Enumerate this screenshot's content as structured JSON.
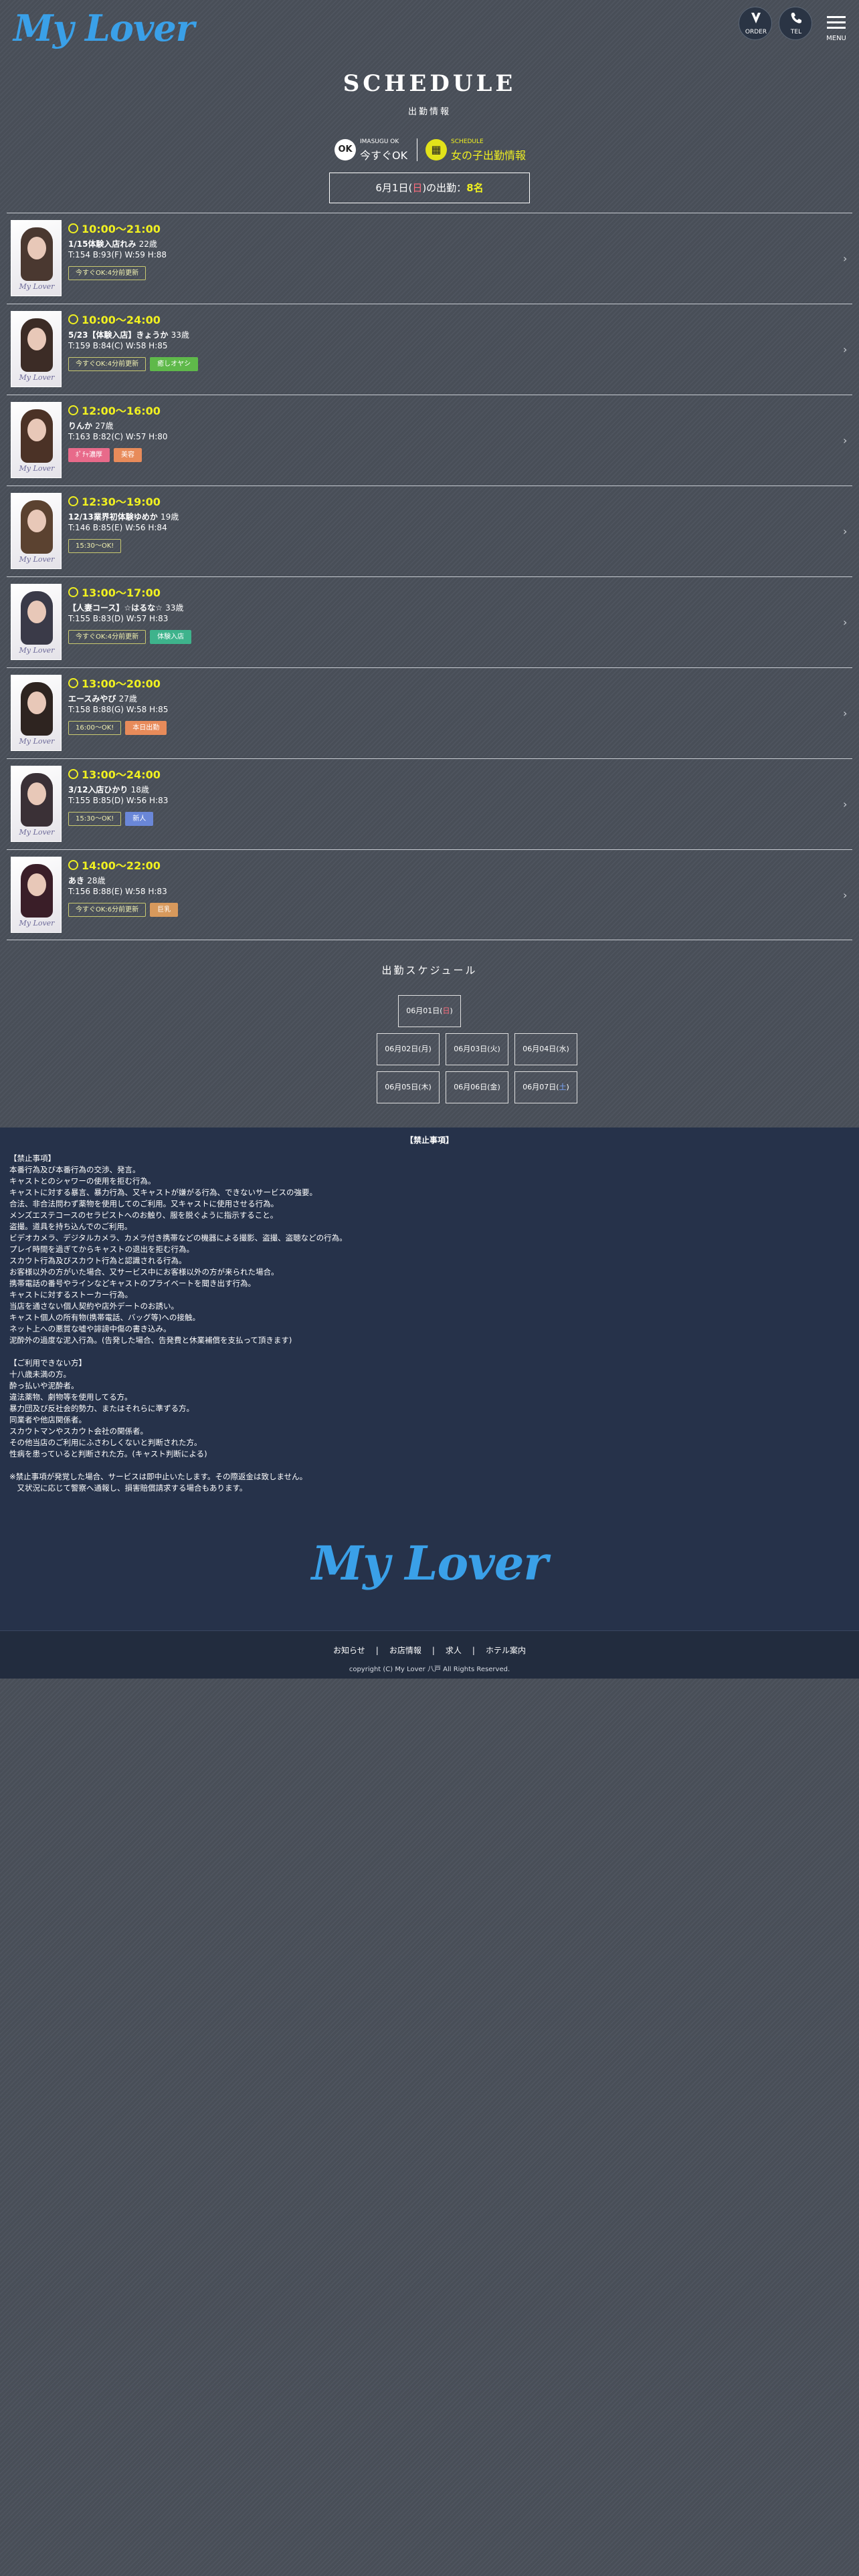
{
  "header": {
    "logo": "My Lover",
    "order_label": "ORDER",
    "tel_label": "TEL",
    "menu_label": "MENU"
  },
  "page": {
    "title": "SCHEDULE",
    "subtitle": "出勤情報"
  },
  "status": {
    "ok_badge": "OK",
    "ok_small": "IMASUGU OK",
    "ok_big": "今すぐOK",
    "sched_small": "SCHEDULE",
    "sched_big": "女の子出勤情報"
  },
  "today": {
    "date": "6月1日(",
    "weekday": "日",
    "suffix": ")の出勤：",
    "count": "8名"
  },
  "casts": [
    {
      "time": "10:00〜21:00",
      "name": "1/15体験入店れみ",
      "age": "22歳",
      "spec": "T:154 B:93(F) W:59 H:88",
      "tags": [
        {
          "label": "今すぐOK:4分前更新",
          "kind": "ok"
        }
      ],
      "hair": "#4a3830"
    },
    {
      "time": "10:00〜24:00",
      "name": "5/23【体験入店】きょうか",
      "age": "33歳",
      "spec": "T:159 B:84(C) W:58 H:85",
      "tags": [
        {
          "label": "今すぐOK:4分前更新",
          "kind": "ok"
        },
        {
          "label": "癒しオヤシ",
          "kind": "green"
        }
      ],
      "hair": "#3c2c26"
    },
    {
      "time": "12:00〜16:00",
      "name": "りんか",
      "age": "27歳",
      "spec": "T:163 B:82(C) W:57 H:80",
      "tags": [
        {
          "label": "ﾎﾟﾁｬ濃厚",
          "kind": "pink"
        },
        {
          "label": "美容",
          "kind": "orange"
        }
      ],
      "hair": "#4b3226"
    },
    {
      "time": "12:30〜19:00",
      "name": "12/13業界初体験ゆめか",
      "age": "19歳",
      "spec": "T:146 B:85(E) W:56 H:84",
      "tags": [
        {
          "label": "15:30〜OK!",
          "kind": "ok"
        }
      ],
      "hair": "#5b4230"
    },
    {
      "time": "13:00〜17:00",
      "name": "【人妻コース】☆はるな☆",
      "age": "33歳",
      "spec": "T:155 B:83(D) W:57 H:83",
      "tags": [
        {
          "label": "今すぐOK:4分前更新",
          "kind": "ok"
        },
        {
          "label": "体験入店",
          "kind": "teal"
        }
      ],
      "hair": "#3a3a48"
    },
    {
      "time": "13:00〜20:00",
      "name": "エースみやび",
      "age": "27歳",
      "spec": "T:158 B:88(G) W:58 H:85",
      "tags": [
        {
          "label": "16:00〜OK!",
          "kind": "ok"
        },
        {
          "label": "本日出勤",
          "kind": "orange"
        }
      ],
      "hair": "#2e2420"
    },
    {
      "time": "13:00〜24:00",
      "name": "3/12入店ひかり",
      "age": "18歳",
      "spec": "T:155 B:85(D) W:56 H:83",
      "tags": [
        {
          "label": "15:30〜OK!",
          "kind": "ok"
        },
        {
          "label": "新人",
          "kind": "blue"
        }
      ],
      "hair": "#3a3036"
    },
    {
      "time": "14:00〜22:00",
      "name": "あき",
      "age": "28歳",
      "spec": "T:156 B:88(E) W:58 H:83",
      "tags": [
        {
          "label": "今すぐOK:6分前更新",
          "kind": "ok"
        },
        {
          "label": "巨乳",
          "kind": "tan"
        }
      ],
      "hair": "#3a1e28"
    }
  ],
  "schedule": {
    "title": "出勤スケジュール",
    "days": [
      {
        "pre": "06月01日(",
        "wd": "日",
        "post": ")",
        "kind": "sun"
      },
      {
        "pre": "06月02日(",
        "wd": "月",
        "post": ")",
        "kind": ""
      },
      {
        "pre": "06月03日(",
        "wd": "火",
        "post": ")",
        "kind": ""
      },
      {
        "pre": "06月04日(",
        "wd": "水",
        "post": ")",
        "kind": ""
      },
      {
        "pre": "06月05日(",
        "wd": "木",
        "post": ")",
        "kind": ""
      },
      {
        "pre": "06月06日(",
        "wd": "金",
        "post": ")",
        "kind": ""
      },
      {
        "pre": "06月07日(",
        "wd": "土",
        "post": ")",
        "kind": "sat"
      }
    ]
  },
  "rules": {
    "heading": "【禁止事項】",
    "lines": [
      "【禁止事項】",
      "本番行為及び本番行為の交渉、発言。",
      "キャストとのシャワーの使用を拒む行為。",
      "キャストに対する暴言、暴力行為、又キャストが嫌がる行為、できないサービスの強要。",
      "合法、非合法問わず薬物を使用してのご利用。又キャストに使用させる行為。",
      "メンズエステコースのセラピストへのお触り、服を脱ぐように指示すること。",
      "盗撮。道具を持ち込んでのご利用。",
      "ビデオカメラ、デジタルカメラ、カメラ付き携帯などの機器による撮影、盗撮、盗聴などの行為。",
      "プレイ時間を過ぎてからキャストの退出を拒む行為。",
      "スカウト行為及びスカウト行為と認識される行為。",
      "お客様以外の方がいた場合、又サービス中にお客様以外の方が来られた場合。",
      "携帯電話の番号やラインなどキャストのプライベートを聞き出す行為。",
      "キャストに対するストーカー行為。",
      "当店を通さない個人契約や店外デートのお誘い。",
      "キャスト個人の所有物(携帯電話、バッグ等)への接触。",
      "ネット上への悪質な嘘や誹謗中傷の書き込み。",
      "泥酔外の過度な泥入行為。(告発した場合、告発費と休業補償を支払って頂きます)",
      "",
      "【ご利用できない方】",
      "十八歳未満の方。",
      "酔っ払いや泥酔者。",
      "違法薬物、劇物等を使用してる方。",
      "暴力団及び反社会的勢力、またはそれらに準ずる方。",
      "同業者や他店関係者。",
      "スカウトマンやスカウト会社の関係者。",
      "その他当店のご利用にふさわしくないと判断された方。",
      "性病を患っていると判断された方。(キャスト判断による)",
      "",
      "※禁止事項が発覚した場合、サービスは即中止いたします。その際返金は致しません。",
      "　又状況に応じて警察へ通報し、損害賠償請求する場合もあります。"
    ],
    "logo": "My Lover"
  },
  "footer": {
    "links": [
      "お知らせ",
      "お店情報",
      "求人",
      "ホテル案内"
    ],
    "separator": "|",
    "copyright": "copyright (C) My Lover 八戸 All Rights Reserved."
  }
}
